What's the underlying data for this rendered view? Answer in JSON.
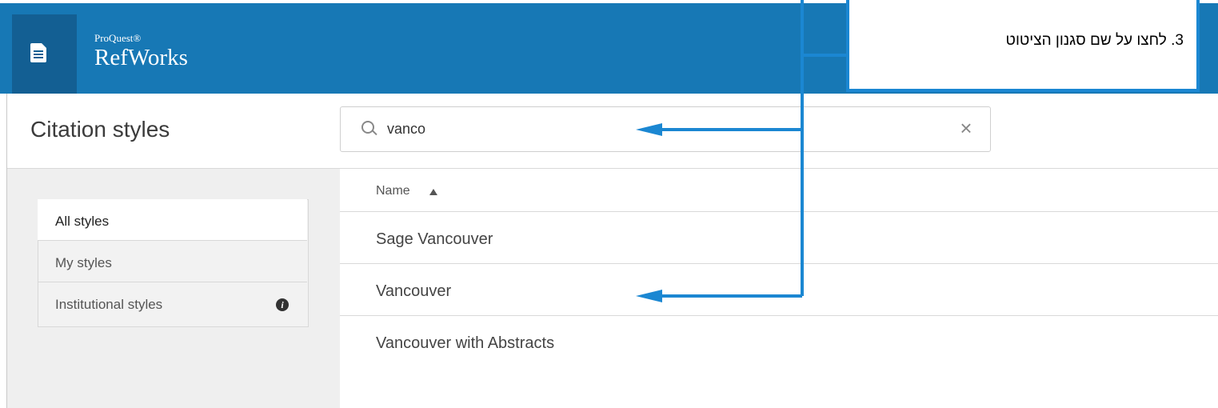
{
  "app": {
    "brand_top": "ProQuest®",
    "brand_name": "RefWorks",
    "logo_icon": "document-icon",
    "header_color": "#1778b5"
  },
  "page": {
    "title": "Citation styles"
  },
  "search": {
    "value": "vanco",
    "search_icon": "search-icon",
    "clear_glyph": "×"
  },
  "sidebar": {
    "items": [
      {
        "label": "All styles",
        "active": true
      },
      {
        "label": "My styles",
        "active": false
      },
      {
        "label": "Institutional styles",
        "active": false,
        "info_glyph": "i"
      }
    ]
  },
  "list": {
    "column_header": "Name",
    "sort": "ascending",
    "rows": [
      {
        "name": "Sage Vancouver"
      },
      {
        "name": "Vancouver"
      },
      {
        "name": "Vancouver with Abstracts"
      }
    ]
  },
  "callout": {
    "text": "3.   לחצו על שם סגנון הציטוט",
    "color": "#1b87d2"
  }
}
